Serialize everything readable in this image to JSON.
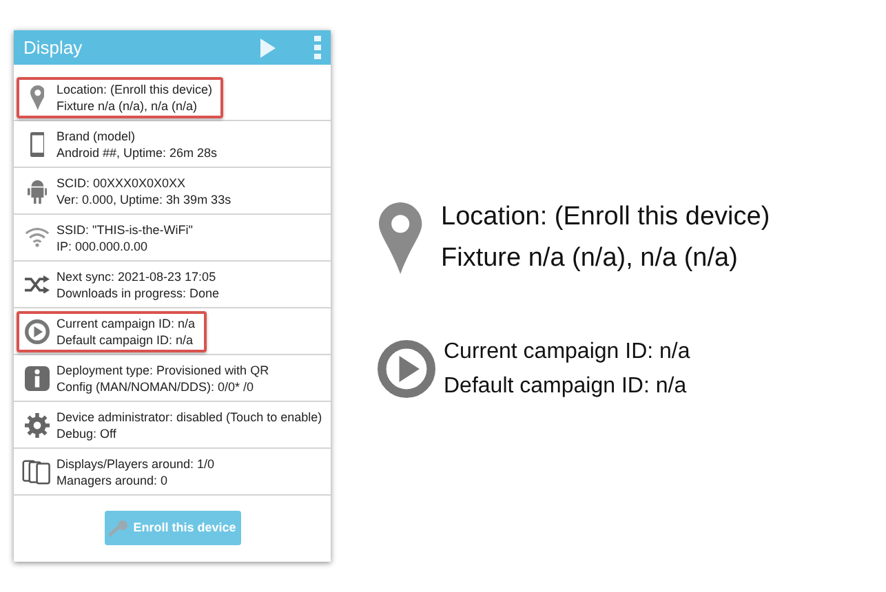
{
  "header": {
    "title": "Display"
  },
  "rows": [
    {
      "kind": "location",
      "highlighted": true,
      "lines": [
        "Location: (Enroll this device)",
        "Fixture n/a (n/a), n/a (n/a)"
      ]
    },
    {
      "kind": "phone",
      "highlighted": false,
      "lines": [
        "Brand (model)",
        "Android ##, Uptime: 26m 28s"
      ]
    },
    {
      "kind": "android",
      "highlighted": false,
      "lines": [
        "SCID: 00XXX0X0X0XX",
        "Ver: 0.000, Uptime: 3h 39m 33s"
      ]
    },
    {
      "kind": "wifi",
      "highlighted": false,
      "lines": [
        "SSID: \"THIS-is-the-WiFi\"",
        "IP: 000.000.0.00"
      ]
    },
    {
      "kind": "sync",
      "highlighted": false,
      "lines": [
        "Next sync: 2021-08-23 17:05",
        "Downloads in progress: Done"
      ]
    },
    {
      "kind": "play",
      "highlighted": true,
      "lines": [
        "Current campaign ID: n/a",
        "Default campaign ID: n/a"
      ]
    },
    {
      "kind": "info",
      "highlighted": false,
      "lines": [
        "Deployment type: Provisioned with QR",
        "Config (MAN/NOMAN/DDS): 0/0* /0"
      ]
    },
    {
      "kind": "gear",
      "highlighted": false,
      "lines": [
        "Device administrator: disabled (Touch to enable)",
        "Debug: Off"
      ]
    },
    {
      "kind": "devices",
      "highlighted": false,
      "lines": [
        "Displays/Players around: 1/0",
        "Managers around: 0"
      ]
    }
  ],
  "enroll_button": {
    "label": "Enroll this device"
  },
  "callouts": [
    {
      "kind": "location",
      "lines": [
        "Location: (Enroll this device)",
        "Fixture n/a (n/a), n/a (n/a)"
      ]
    },
    {
      "kind": "play",
      "lines": [
        "Current campaign ID: n/a",
        "Default campaign ID: n/a"
      ]
    }
  ]
}
